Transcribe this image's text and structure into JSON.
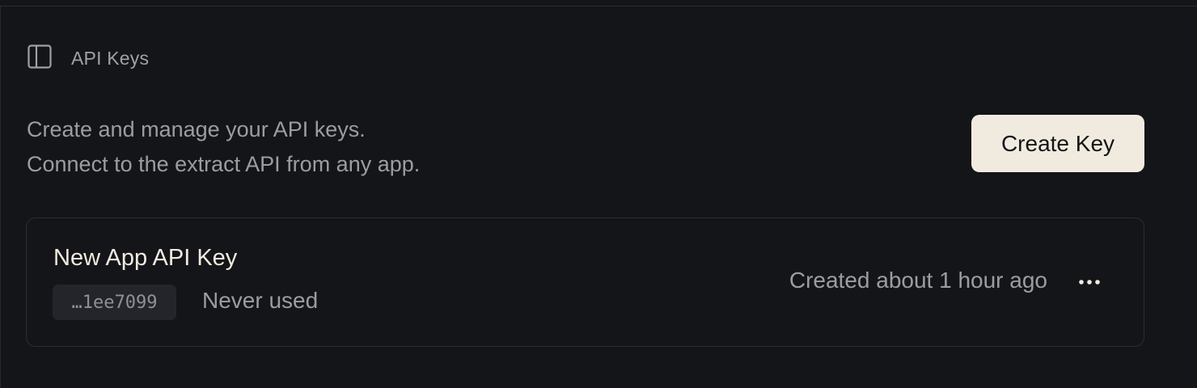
{
  "header": {
    "title": "API Keys",
    "toggle_icon": "sidebar-panel-icon"
  },
  "description": {
    "line1": "Create and manage your API keys.",
    "line2": "Connect to the extract API from any app."
  },
  "actions": {
    "create_label": "Create Key"
  },
  "keys": [
    {
      "name": "New App API Key",
      "masked": "…1ee7099",
      "usage": "Never used",
      "created": "Created about 1 hour ago",
      "menu_icon": "more-horizontal-icon"
    }
  ],
  "colors": {
    "background": "#141518",
    "border": "#2b2d32",
    "text_primary": "#f1ebdf",
    "text_muted": "#9b9da2",
    "button_bg": "#f1ebdf",
    "chip_bg": "#23252a"
  }
}
